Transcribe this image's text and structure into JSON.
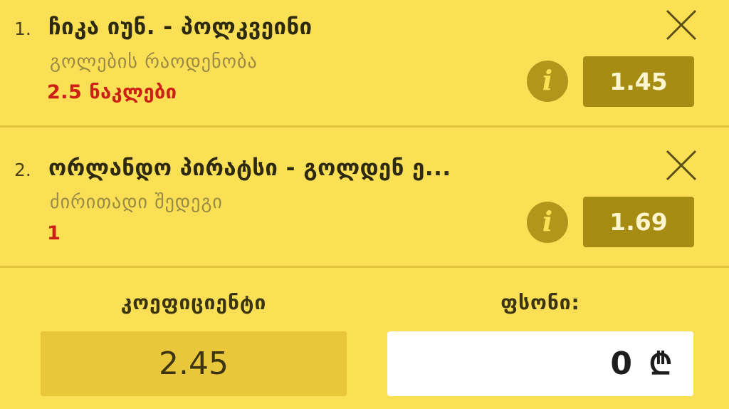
{
  "bets": [
    {
      "index": "1.",
      "title": "ჩიკა იუნ. - პოლკვეინი",
      "market": "გოლების რაოდენობა",
      "pick": "2.5 ნაკლები",
      "odd": "1.45",
      "info_icon": "info-icon",
      "close_icon": "close-icon"
    },
    {
      "index": "2.",
      "title": "ორლანდო პირატსი - გოლდენ ე...",
      "market": "ძირითადი შედეგი",
      "pick": "1",
      "odd": "1.69",
      "info_icon": "info-icon",
      "close_icon": "close-icon"
    }
  ],
  "footer": {
    "coefficient_label": "კოეფიციენტი",
    "coefficient_value": "2.45",
    "stake_label": "ფსონი:",
    "stake_value": "0",
    "currency_symbol": "₾"
  },
  "colors": {
    "background": "#fbdf55",
    "pick_red": "#cc1f15",
    "odd_button": "#a78c14",
    "info_button": "#b3951c"
  }
}
